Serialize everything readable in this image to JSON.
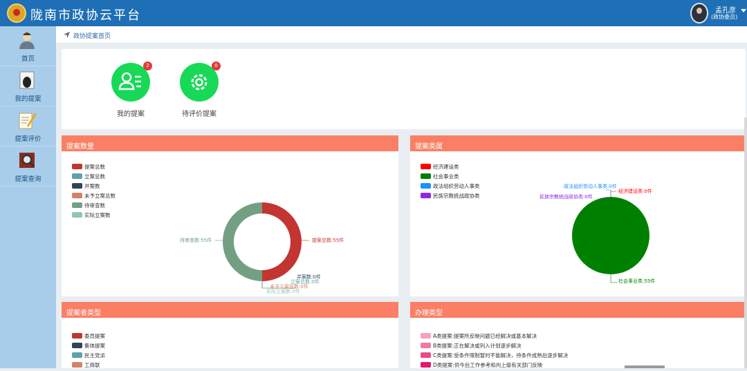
{
  "header": {
    "title": "陇南市政协云平台",
    "user_name": "孟孔彦",
    "user_role": "(政协委员)"
  },
  "sidebar": {
    "items": [
      {
        "label": "首页",
        "icon": "user-icon"
      },
      {
        "label": "我的提案",
        "icon": "proposal-icon"
      },
      {
        "label": "提案评价",
        "icon": "evaluate-icon"
      },
      {
        "label": "提案查询",
        "icon": "search-icon"
      }
    ]
  },
  "breadcrumb": {
    "text": "政协提案首页"
  },
  "quick": {
    "items": [
      {
        "label": "我的提案",
        "badge": "2",
        "icon": "person-list-icon"
      },
      {
        "label": "待评价提案",
        "badge": "0",
        "icon": "gear-icon"
      }
    ]
  },
  "panels": {
    "count": {
      "title": "提案数量"
    },
    "category": {
      "title": "提案类属"
    },
    "proposer": {
      "title": "提案者类型"
    },
    "handling": {
      "title": "办理类型"
    }
  },
  "colors": {
    "accent_header": "#fb7f64",
    "topbar": "#1e6fb5",
    "sidebar": "#a8cdea",
    "quick_icon": "#18d957"
  },
  "chart_data": [
    {
      "type": "pie",
      "variant": "donut",
      "legend_placement": "top-left",
      "legend": [
        "提案总数",
        "立案总数",
        "并案数",
        "未予立案总数",
        "待审查数",
        "实际立案数"
      ],
      "colors": [
        "#c23531",
        "#61a0a8",
        "#2f4554",
        "#d48265",
        "#749f83",
        "#91c7ae"
      ],
      "values": [
        55,
        0,
        0,
        0,
        55,
        0
      ],
      "labels": [
        "提案总数:55件",
        "立案总数:0件",
        "并案数:0件",
        "未予立案总数:0件",
        "待审查数:55件",
        "实际立案数:0件"
      ]
    },
    {
      "type": "pie",
      "legend_placement": "top-left",
      "legend": [
        "经济建设类",
        "社会事业类",
        "政法组织劳动人事类",
        "民族宗教统战政协类"
      ],
      "colors": [
        "#ff0000",
        "#008000",
        "#1e90ff",
        "#8a2be2"
      ],
      "values": [
        0,
        55,
        0,
        0
      ],
      "labels": [
        "经济建设类:0件",
        "社会事业类:55件",
        "政法组织劳动人事类:0件",
        "民族宗教统战政协类:0件"
      ]
    },
    {
      "type": "pie",
      "legend_placement": "top-left",
      "legend": [
        "委员提案",
        "集体提案",
        "民主党派",
        "工商联"
      ],
      "colors": [
        "#c23531",
        "#2f4554",
        "#61a0a8",
        "#d48265"
      ]
    },
    {
      "type": "pie",
      "legend_placement": "top-left",
      "legend": [
        "A类提案:提案所反映问题已经解决或基本解决",
        "B类提案:正在解决或列入计划逐步解决",
        "C类提案:受条件限制暂时不能解决，待条件成熟后逐步解决",
        "D类提案:供今后工作参考和向上级有关部门反映"
      ],
      "colors": [
        "#f7a1c4",
        "#f07aa6",
        "#e84a86",
        "#e0186a"
      ]
    }
  ]
}
